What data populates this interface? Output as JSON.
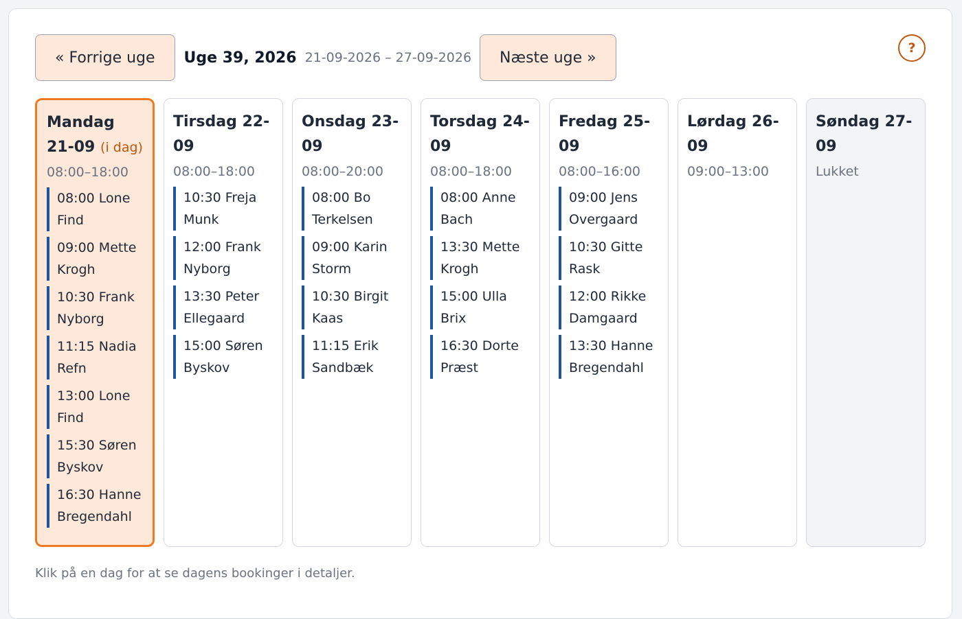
{
  "toolbar": {
    "prev_label": "« Forrige uge",
    "week_title": "Uge 39, 2026",
    "week_range": "21-09-2026 – 27-09-2026",
    "next_label": "Næste uge »",
    "help_label": "?"
  },
  "days": [
    {
      "title": "Mandag 21-09",
      "today_label": "(i dag)",
      "hours": "08:00–18:00",
      "bookings": [
        "08:00 Lone Find",
        "09:00 Mette Krogh",
        "10:30 Frank Nyborg",
        "11:15 Nadia Refn",
        "13:00 Lone Find",
        "15:30 Søren Byskov",
        "16:30 Hanne Bregendahl"
      ]
    },
    {
      "title": "Tirsdag 22-09",
      "hours": "08:00–18:00",
      "bookings": [
        "10:30 Freja Munk",
        "12:00 Frank Nyborg",
        "13:30 Peter Ellegaard",
        "15:00 Søren Byskov"
      ]
    },
    {
      "title": "Onsdag 23-09",
      "hours": "08:00–20:00",
      "bookings": [
        "08:00 Bo Terkelsen",
        "09:00 Karin Storm",
        "10:30 Birgit Kaas",
        "11:15 Erik Sandbæk"
      ]
    },
    {
      "title": "Torsdag 24-09",
      "hours": "08:00–18:00",
      "bookings": [
        "08:00 Anne Bach",
        "13:30 Mette Krogh",
        "15:00 Ulla Brix",
        "16:30 Dorte Præst"
      ]
    },
    {
      "title": "Fredag 25-09",
      "hours": "08:00–16:00",
      "bookings": [
        "09:00 Jens Overgaard",
        "10:30 Gitte Rask",
        "12:00 Rikke Damgaard",
        "13:30 Hanne Bregendahl"
      ]
    },
    {
      "title": "Lørdag 26-09",
      "hours": "09:00–13:00",
      "bookings": []
    },
    {
      "title": "Søndag 27-09",
      "hours": "Lukket",
      "bookings": []
    }
  ],
  "hint": "Klik på en dag for at se dagens bookinger i detaljer.",
  "colors": {
    "accent": "#f07a22",
    "today_bg": "#fde8d9",
    "booking_bar": "#1e55a0"
  }
}
